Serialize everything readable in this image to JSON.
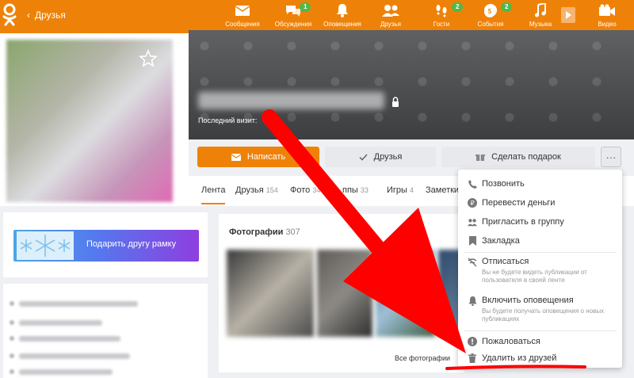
{
  "topbar": {
    "back_label": "Друзья",
    "nav": [
      {
        "label": "Сообщения",
        "icon": "envelope-icon"
      },
      {
        "label": "Обсуждения",
        "icon": "chat-icon",
        "badge": "1"
      },
      {
        "label": "Оповещения",
        "icon": "bell-icon"
      },
      {
        "label": "Друзья",
        "icon": "friends-icon"
      },
      {
        "label": "Гости",
        "icon": "footprints-icon",
        "badge": "2"
      },
      {
        "label": "События",
        "icon": "events-icon",
        "badge": "2",
        "badge2": "5"
      },
      {
        "label": "Музыка",
        "icon": "music-note-icon"
      },
      {
        "label": "Видео",
        "icon": "video-camera-icon"
      }
    ]
  },
  "profile": {
    "last_visit_label": "Последний визит:"
  },
  "actions": {
    "write": "Написать",
    "friends": "Друзья",
    "gift": "Сделать подарок",
    "more": "···"
  },
  "tabs": [
    {
      "label": "Лента",
      "count": ""
    },
    {
      "label": "Друзья",
      "count": "154"
    },
    {
      "label": "Фото",
      "count": "34"
    },
    {
      "label": "ппы",
      "count": "33"
    },
    {
      "label": "Игры",
      "count": "4"
    },
    {
      "label": "Заметки",
      "count": ""
    }
  ],
  "frame_card": {
    "button_label": "Подарить другу рамку"
  },
  "photos": {
    "title": "Фотографии",
    "count": "307",
    "all_label": "Все фотографии"
  },
  "dropdown": {
    "items": [
      {
        "label": "Позвонить",
        "icon": "phone-icon"
      },
      {
        "label": "Перевести деньги",
        "icon": "ruble-icon"
      },
      {
        "label": "Пригласить в группу",
        "icon": "group-icon"
      },
      {
        "label": "Закладка",
        "icon": "bookmark-icon"
      },
      {
        "label": "Отписаться",
        "icon": "unsubscribe-icon",
        "desc": "Вы не будете видеть публикации от пользователя в своей ленте"
      },
      {
        "label": "Включить оповещения",
        "icon": "bell-icon",
        "desc": "Вы будете получать оповещения о новых публикациях"
      },
      {
        "label": "Пожаловаться",
        "icon": "warning-icon"
      },
      {
        "label": "Удалить из друзей",
        "icon": "trash-icon"
      }
    ]
  },
  "colors": {
    "brand_orange": "#ee8208",
    "badge_green": "#52b848",
    "annotation_red": "#ff0000"
  }
}
